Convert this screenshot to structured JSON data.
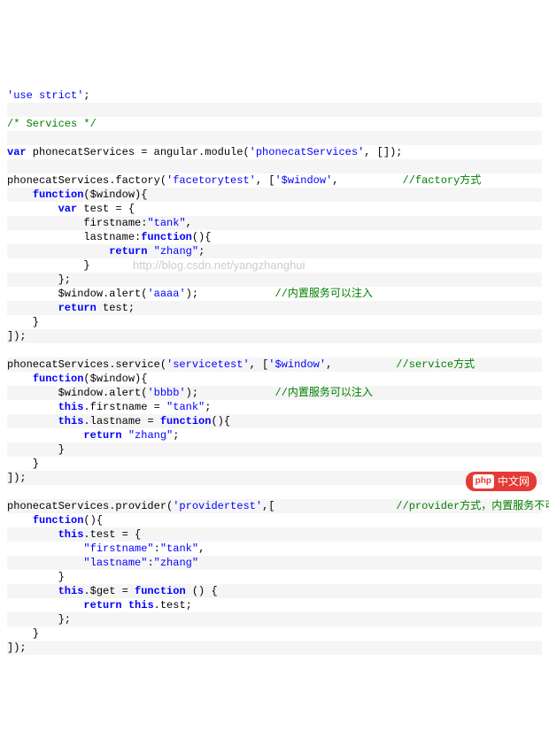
{
  "watermark": "http://blog.csdn.net/yangzhanghui",
  "badge": {
    "logo": "php",
    "text": "中文网"
  },
  "lines": [
    [
      {
        "c": "str",
        "t": "'use strict'"
      },
      {
        "c": "plain",
        "t": ";"
      }
    ],
    [],
    [
      {
        "c": "com",
        "t": "/* Services */"
      }
    ],
    [],
    [
      {
        "c": "kw",
        "t": "var"
      },
      {
        "c": "plain",
        "t": " phonecatServices = angular.module("
      },
      {
        "c": "str",
        "t": "'phonecatServices'"
      },
      {
        "c": "plain",
        "t": ", []);"
      }
    ],
    [],
    [
      {
        "c": "plain",
        "t": "phonecatServices.factory("
      },
      {
        "c": "str",
        "t": "'facetorytest'"
      },
      {
        "c": "plain",
        "t": ", ["
      },
      {
        "c": "str",
        "t": "'$window'"
      },
      {
        "c": "plain",
        "t": ",          "
      },
      {
        "c": "com",
        "t": "//factory方式"
      }
    ],
    [
      {
        "c": "plain",
        "t": "    "
      },
      {
        "c": "fn",
        "t": "function"
      },
      {
        "c": "plain",
        "t": "($window){"
      }
    ],
    [
      {
        "c": "plain",
        "t": "        "
      },
      {
        "c": "kw",
        "t": "var"
      },
      {
        "c": "plain",
        "t": " test = {"
      }
    ],
    [
      {
        "c": "plain",
        "t": "            firstname:"
      },
      {
        "c": "str",
        "t": "\"tank\""
      },
      {
        "c": "plain",
        "t": ","
      }
    ],
    [
      {
        "c": "plain",
        "t": "            lastname:"
      },
      {
        "c": "fn",
        "t": "function"
      },
      {
        "c": "plain",
        "t": "(){"
      }
    ],
    [
      {
        "c": "plain",
        "t": "                "
      },
      {
        "c": "kw",
        "t": "return"
      },
      {
        "c": "plain",
        "t": " "
      },
      {
        "c": "str",
        "t": "\"zhang\""
      },
      {
        "c": "plain",
        "t": ";"
      }
    ],
    [
      {
        "c": "plain",
        "t": "            }"
      }
    ],
    [
      {
        "c": "plain",
        "t": "        };"
      }
    ],
    [
      {
        "c": "plain",
        "t": "        $window.alert("
      },
      {
        "c": "str",
        "t": "'aaaa'"
      },
      {
        "c": "plain",
        "t": ");            "
      },
      {
        "c": "com",
        "t": "//内置服务可以注入"
      }
    ],
    [
      {
        "c": "plain",
        "t": "        "
      },
      {
        "c": "kw",
        "t": "return"
      },
      {
        "c": "plain",
        "t": " test;"
      }
    ],
    [
      {
        "c": "plain",
        "t": "    }"
      }
    ],
    [
      {
        "c": "plain",
        "t": "]);"
      }
    ],
    [],
    [
      {
        "c": "plain",
        "t": "phonecatServices.service("
      },
      {
        "c": "str",
        "t": "'servicetest'"
      },
      {
        "c": "plain",
        "t": ", ["
      },
      {
        "c": "str",
        "t": "'$window'"
      },
      {
        "c": "plain",
        "t": ",          "
      },
      {
        "c": "com",
        "t": "//service方式"
      }
    ],
    [
      {
        "c": "plain",
        "t": "    "
      },
      {
        "c": "fn",
        "t": "function"
      },
      {
        "c": "plain",
        "t": "($window){"
      }
    ],
    [
      {
        "c": "plain",
        "t": "        $window.alert("
      },
      {
        "c": "str",
        "t": "'bbbb'"
      },
      {
        "c": "plain",
        "t": ");            "
      },
      {
        "c": "com",
        "t": "//内置服务可以注入"
      }
    ],
    [
      {
        "c": "plain",
        "t": "        "
      },
      {
        "c": "thiskw",
        "t": "this"
      },
      {
        "c": "plain",
        "t": ".firstname = "
      },
      {
        "c": "str",
        "t": "\"tank\""
      },
      {
        "c": "plain",
        "t": ";"
      }
    ],
    [
      {
        "c": "plain",
        "t": "        "
      },
      {
        "c": "thiskw",
        "t": "this"
      },
      {
        "c": "plain",
        "t": ".lastname = "
      },
      {
        "c": "fn",
        "t": "function"
      },
      {
        "c": "plain",
        "t": "(){"
      }
    ],
    [
      {
        "c": "plain",
        "t": "            "
      },
      {
        "c": "kw",
        "t": "return"
      },
      {
        "c": "plain",
        "t": " "
      },
      {
        "c": "str",
        "t": "\"zhang\""
      },
      {
        "c": "plain",
        "t": ";"
      }
    ],
    [
      {
        "c": "plain",
        "t": "        }"
      }
    ],
    [
      {
        "c": "plain",
        "t": "    }"
      }
    ],
    [
      {
        "c": "plain",
        "t": "]);"
      }
    ],
    [],
    [
      {
        "c": "plain",
        "t": "phonecatServices.provider("
      },
      {
        "c": "str",
        "t": "'providertest'"
      },
      {
        "c": "plain",
        "t": ",[                   "
      },
      {
        "c": "com",
        "t": "//provider方式，内置服务不可以注入"
      }
    ],
    [
      {
        "c": "plain",
        "t": "    "
      },
      {
        "c": "fn",
        "t": "function"
      },
      {
        "c": "plain",
        "t": "(){"
      }
    ],
    [
      {
        "c": "plain",
        "t": "        "
      },
      {
        "c": "thiskw",
        "t": "this"
      },
      {
        "c": "plain",
        "t": ".test = {"
      }
    ],
    [
      {
        "c": "plain",
        "t": "            "
      },
      {
        "c": "str",
        "t": "\"firstname\""
      },
      {
        "c": "plain",
        "t": ":"
      },
      {
        "c": "str",
        "t": "\"tank\""
      },
      {
        "c": "plain",
        "t": ","
      }
    ],
    [
      {
        "c": "plain",
        "t": "            "
      },
      {
        "c": "str",
        "t": "\"lastname\""
      },
      {
        "c": "plain",
        "t": ":"
      },
      {
        "c": "str",
        "t": "\"zhang\""
      }
    ],
    [
      {
        "c": "plain",
        "t": "        }"
      }
    ],
    [
      {
        "c": "plain",
        "t": "        "
      },
      {
        "c": "thiskw",
        "t": "this"
      },
      {
        "c": "plain",
        "t": ".$get = "
      },
      {
        "c": "fn",
        "t": "function"
      },
      {
        "c": "plain",
        "t": " () {"
      }
    ],
    [
      {
        "c": "plain",
        "t": "            "
      },
      {
        "c": "kw",
        "t": "return"
      },
      {
        "c": "plain",
        "t": " "
      },
      {
        "c": "thiskw",
        "t": "this"
      },
      {
        "c": "plain",
        "t": ".test;"
      }
    ],
    [
      {
        "c": "plain",
        "t": "        };"
      }
    ],
    [
      {
        "c": "plain",
        "t": "    }"
      }
    ],
    [
      {
        "c": "plain",
        "t": "]);"
      }
    ]
  ]
}
